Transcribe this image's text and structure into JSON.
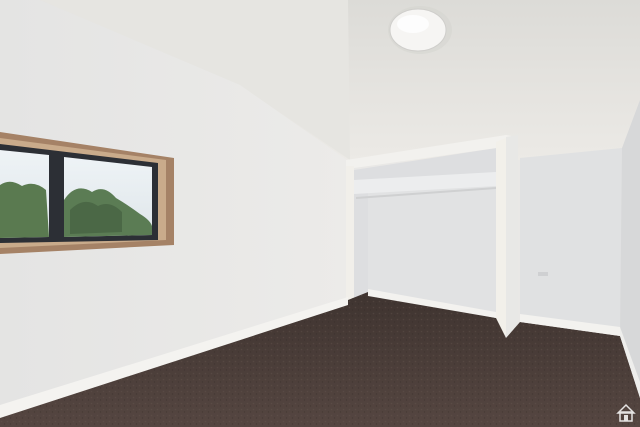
{
  "scene": {
    "description_icon": "house-watermark-icon",
    "colors": {
      "ceiling": "#e4e3df",
      "left_wall": "#e6e6e4",
      "back_wall": "#e2e3e4",
      "right_wall": "#dedfe0",
      "carpet": "#4a3d37",
      "trim": "#f3f2ef",
      "window_frame": "#9b7b62",
      "window_glass": "#dfe9ef",
      "foliage": "#5b7a52",
      "closet_interior": "#dfe0e1",
      "light_fixture": "#f4f3f1"
    }
  }
}
